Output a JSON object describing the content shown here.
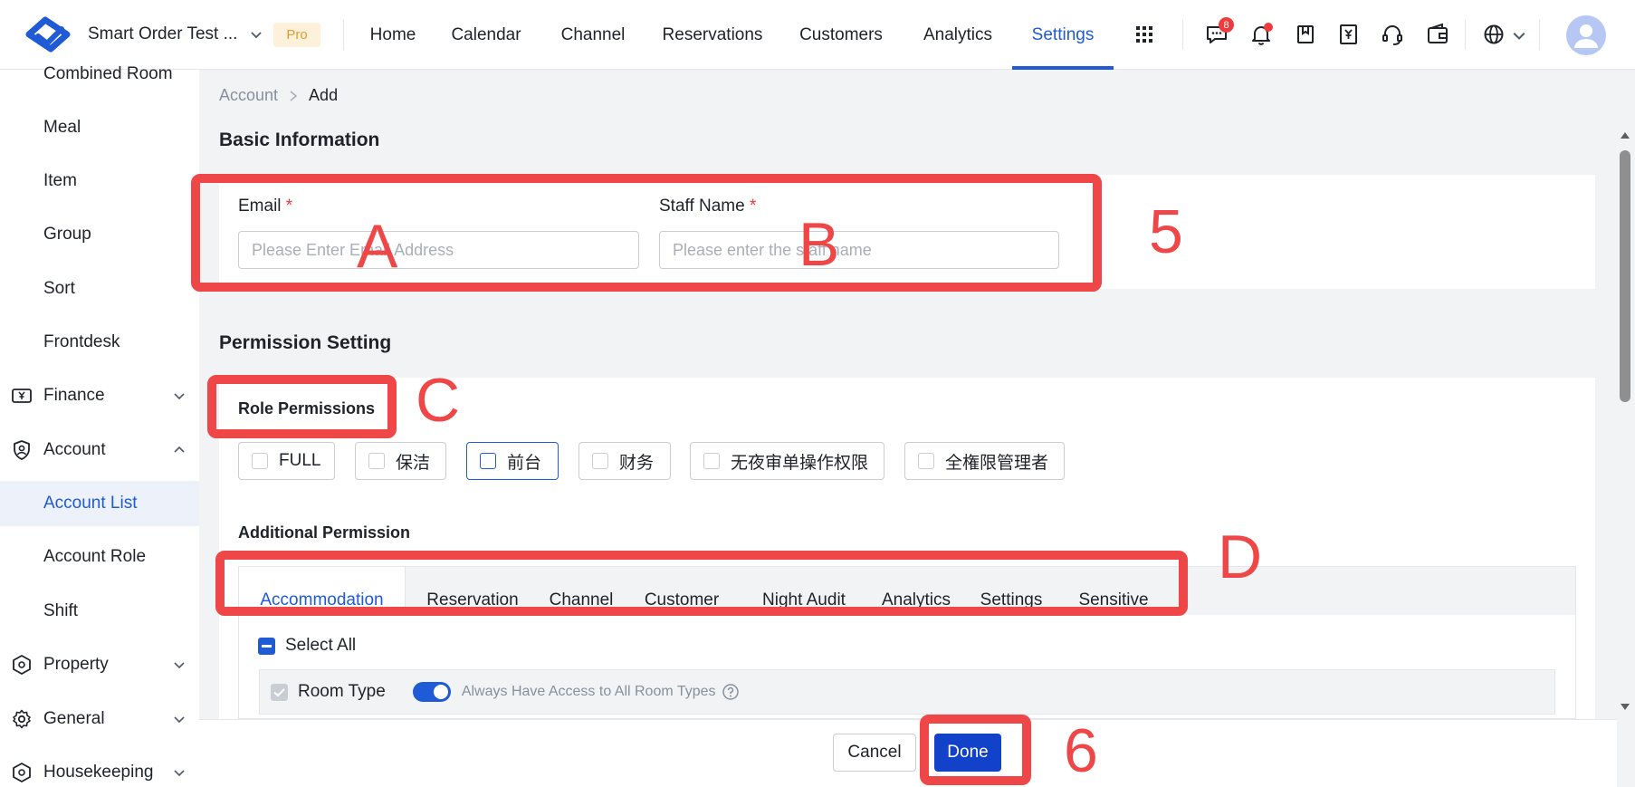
{
  "header": {
    "hotel_name": "Smart Order Test ...",
    "plan_badge": "Pro",
    "nav": [
      "Home",
      "Calendar",
      "Channel",
      "Reservations",
      "Customers",
      "Analytics",
      "Settings"
    ],
    "active_nav": "Settings",
    "message_count": "8",
    "accent_color": "#1f5bd6"
  },
  "sidebar": {
    "items": [
      "Combined Room",
      "Meal",
      "Item",
      "Group",
      "Sort",
      "Frontdesk"
    ],
    "groups": {
      "finance": "Finance",
      "account": "Account",
      "property": "Property",
      "general": "General",
      "housekeeping": "Housekeeping"
    },
    "account_children": [
      "Account List",
      "Account Role",
      "Shift"
    ],
    "active_item": "Account List"
  },
  "breadcrumb": {
    "root": "Account",
    "current": "Add"
  },
  "basic_info": {
    "title": "Basic Information",
    "email_label": "Email",
    "email_placeholder": "Please Enter Email Address",
    "email_value": "",
    "staff_label": "Staff Name",
    "staff_placeholder": "Please enter the staff name",
    "staff_value": "",
    "required_mark": "*"
  },
  "permission": {
    "title": "Permission Setting",
    "role_title": "Role Permissions",
    "roles": [
      "FULL",
      "保洁",
      "前台",
      "财务",
      "无夜审单操作权限",
      "全権限管理者"
    ],
    "selected_role": "前台",
    "additional_title": "Additional Permission",
    "tabs": [
      "Accommodation",
      "Reservation",
      "Channel",
      "Customer",
      "Night Audit",
      "Analytics",
      "Settings",
      "Sensitive"
    ],
    "active_tab": "Accommodation",
    "select_all": "Select All",
    "room_type_label": "Room Type",
    "room_type_toggle_on": true,
    "room_type_hint": "Always Have Access to All Room Types"
  },
  "footer": {
    "cancel": "Cancel",
    "done": "Done"
  },
  "annotations": {
    "a": "A",
    "b": "B",
    "c": "C",
    "d": "D",
    "five": "5",
    "six": "6",
    "color": "#ef4747"
  }
}
